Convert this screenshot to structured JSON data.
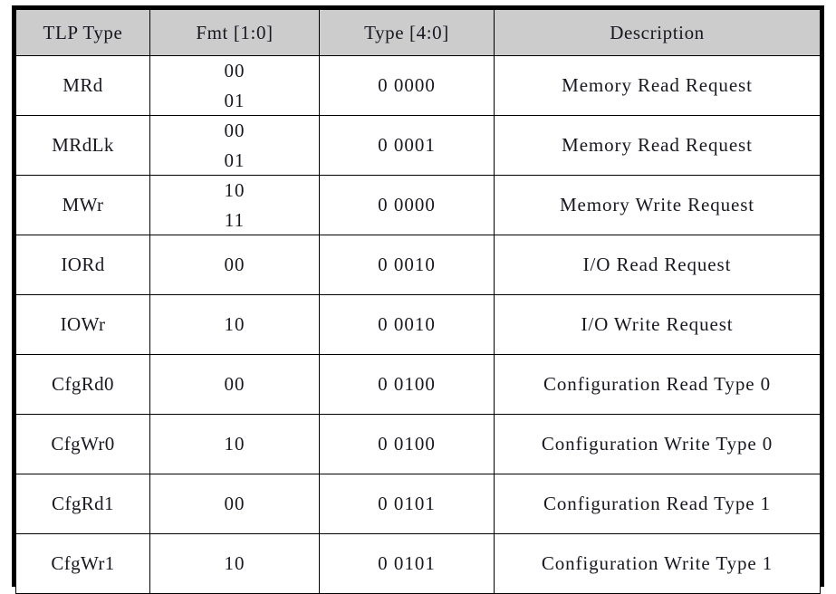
{
  "table": {
    "columns": [
      {
        "key": "tlp",
        "label": "TLP Type"
      },
      {
        "key": "fmt",
        "label": "Fmt [1:0]"
      },
      {
        "key": "type",
        "label": "Type [4:0]"
      },
      {
        "key": "desc",
        "label": "Description"
      }
    ],
    "header_background": "#cccccc",
    "border_color": "#000000",
    "text_color": "#181820",
    "rows": [
      {
        "tlp": "MRd",
        "fmt": [
          "00",
          "01"
        ],
        "type": "0 0000",
        "desc": "Memory Read Request"
      },
      {
        "tlp": "MRdLk",
        "fmt": [
          "00",
          "01"
        ],
        "type": "0 0001",
        "desc": "Memory Read Request"
      },
      {
        "tlp": "MWr",
        "fmt": [
          "10",
          "11"
        ],
        "type": "0 0000",
        "desc": "Memory Write Request"
      },
      {
        "tlp": "IORd",
        "fmt": [
          "00"
        ],
        "type": "0 0010",
        "desc": "I/O Read Request"
      },
      {
        "tlp": "IOWr",
        "fmt": [
          "10"
        ],
        "type": "0 0010",
        "desc": "I/O Write Request"
      },
      {
        "tlp": "CfgRd0",
        "fmt": [
          "00"
        ],
        "type": "0 0100",
        "desc": "Configuration Read Type 0"
      },
      {
        "tlp": "CfgWr0",
        "fmt": [
          "10"
        ],
        "type": "0 0100",
        "desc": "Configuration Write Type 0"
      },
      {
        "tlp": "CfgRd1",
        "fmt": [
          "00"
        ],
        "type": "0 0101",
        "desc": "Configuration Read Type 1"
      },
      {
        "tlp": "CfgWr1",
        "fmt": [
          "10"
        ],
        "type": "0 0101",
        "desc": "Configuration Write Type 1"
      }
    ]
  }
}
